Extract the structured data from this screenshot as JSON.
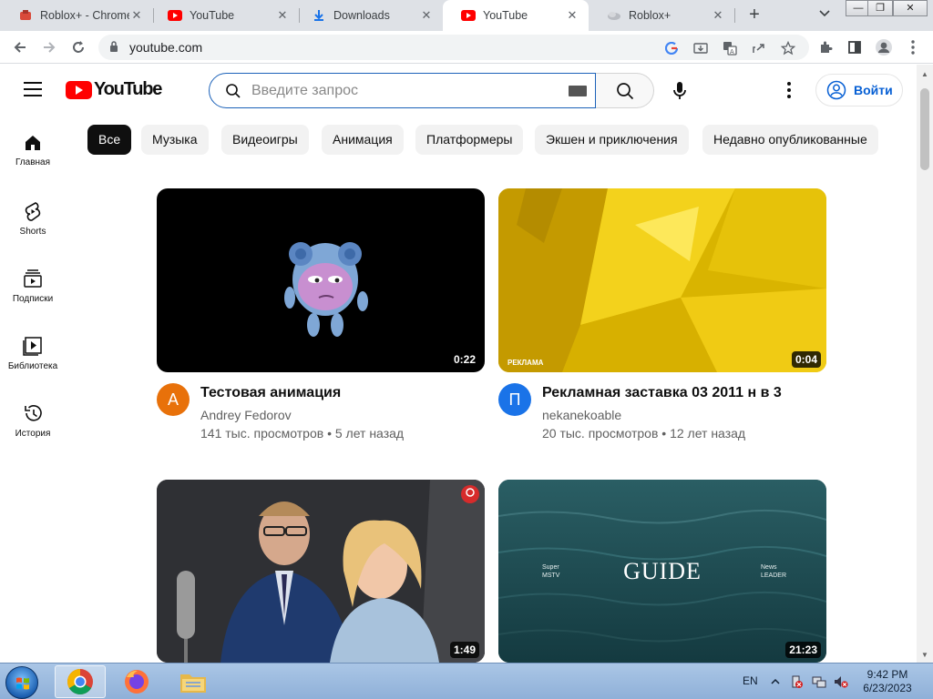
{
  "browser": {
    "tabs": [
      {
        "title": "Roblox+ - Chrome",
        "favicon": "roblox-plus-icon",
        "active": false
      },
      {
        "title": "YouTube",
        "favicon": "youtube-icon",
        "active": false
      },
      {
        "title": "Downloads",
        "favicon": "download-icon",
        "active": false
      },
      {
        "title": "YouTube",
        "favicon": "youtube-icon",
        "active": true
      },
      {
        "title": "Roblox+",
        "favicon": "roblox-plus-icon",
        "active": false
      }
    ],
    "url": "youtube.com"
  },
  "youtube": {
    "logo_text": "YouTube",
    "search_placeholder": "Введите запрос",
    "signin_label": "Войти",
    "sidenav": [
      {
        "label": "Главная",
        "icon": "home-icon"
      },
      {
        "label": "Shorts",
        "icon": "shorts-icon"
      },
      {
        "label": "Подписки",
        "icon": "subscriptions-icon"
      },
      {
        "label": "Библиотека",
        "icon": "library-icon"
      },
      {
        "label": "История",
        "icon": "history-icon"
      }
    ],
    "chips": [
      "Все",
      "Музыка",
      "Видеоигры",
      "Анимация",
      "Платформеры",
      "Экшен и приключения",
      "Недавно опубликованные"
    ],
    "videos": [
      {
        "title": "Тестовая анимация",
        "channel": "Andrey Fedorov",
        "meta": "141 тыс. просмотров • 5 лет назад",
        "duration": "0:22",
        "avatar_letter": "A",
        "avatar_color": "#e8710a"
      },
      {
        "title": "Рекламная заставка 03 2011 н в 3",
        "channel": "nekanekoable",
        "meta": "20 тыс. просмотров • 12 лет назад",
        "duration": "0:04",
        "avatar_letter": "П",
        "avatar_color": "#1a73e8",
        "thumb_badge": "РЕКЛАМА"
      },
      {
        "duration": "1:49"
      },
      {
        "duration": "21:23",
        "thumb_text": "GUIDE",
        "thumb_left_top": "Super",
        "thumb_left_bottom": "MSTV",
        "thumb_right_top": "News",
        "thumb_right_bottom": "LEADER"
      }
    ]
  },
  "taskbar": {
    "lang": "EN",
    "time": "9:42 PM",
    "date": "6/23/2023"
  },
  "colors": {
    "yt_red": "#ff0000",
    "link_blue": "#065fd4"
  }
}
